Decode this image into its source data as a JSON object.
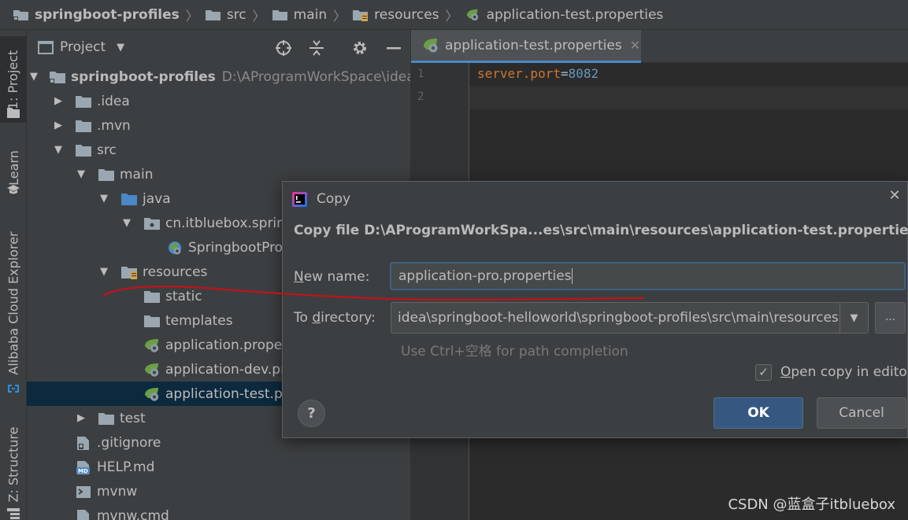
{
  "breadcrumb": [
    {
      "label": "springboot-profiles",
      "icon": "module-folder-icon"
    },
    {
      "label": "src",
      "icon": "folder-icon"
    },
    {
      "label": "main",
      "icon": "folder-icon"
    },
    {
      "label": "resources",
      "icon": "resources-folder-icon"
    },
    {
      "label": "application-test.properties",
      "icon": "spring-properties-icon"
    }
  ],
  "toolstrip": {
    "project": "1: Project",
    "learn": "Learn",
    "alibaba": "Alibaba Cloud Explorer",
    "structure": "Z: Structure"
  },
  "project_panel": {
    "title": "Project",
    "root_name": "springboot-profiles",
    "root_path": "D:\\AProgramWorkSpace\\idea\\s",
    "items": [
      {
        "label": ".idea",
        "level": 1,
        "icon": "folder-icon",
        "arrow": "collapsed"
      },
      {
        "label": ".mvn",
        "level": 1,
        "icon": "folder-icon",
        "arrow": "collapsed"
      },
      {
        "label": "src",
        "level": 1,
        "icon": "folder-icon",
        "arrow": "expanded"
      },
      {
        "label": "main",
        "level": 2,
        "icon": "folder-icon",
        "arrow": "expanded"
      },
      {
        "label": "java",
        "level": 3,
        "icon": "source-folder-icon",
        "arrow": "expanded"
      },
      {
        "label": "cn.itbluebox.sprin",
        "level": 4,
        "icon": "package-icon",
        "arrow": "expanded"
      },
      {
        "label": "SpringbootPro",
        "level": 5,
        "icon": "spring-class-icon",
        "arrow": "none"
      },
      {
        "label": "resources",
        "level": 3,
        "icon": "resources-folder-icon",
        "arrow": "expanded"
      },
      {
        "label": "static",
        "level": 4,
        "icon": "folder-icon",
        "arrow": "none"
      },
      {
        "label": "templates",
        "level": 4,
        "icon": "folder-icon",
        "arrow": "none"
      },
      {
        "label": "application.proper",
        "level": 4,
        "icon": "spring-properties-icon",
        "arrow": "none"
      },
      {
        "label": "application-dev.pr",
        "level": 4,
        "icon": "spring-properties-icon",
        "arrow": "none"
      },
      {
        "label": "application-test.pr",
        "level": 4,
        "icon": "spring-properties-icon",
        "arrow": "none",
        "selected": true
      },
      {
        "label": "test",
        "level": 2,
        "icon": "folder-icon",
        "arrow": "collapsed"
      },
      {
        "label": ".gitignore",
        "level": 1,
        "icon": "gitignore-file-icon",
        "arrow": "none"
      },
      {
        "label": "HELP.md",
        "level": 1,
        "icon": "markdown-file-icon",
        "arrow": "none"
      },
      {
        "label": "mvnw",
        "level": 1,
        "icon": "shell-script-icon",
        "arrow": "none"
      },
      {
        "label": "mvnw.cmd",
        "level": 1,
        "icon": "text-file-icon",
        "arrow": "none"
      }
    ]
  },
  "editor": {
    "tab_label": "application-test.properties",
    "line_numbers": [
      "1",
      "2"
    ],
    "code_key": "server.port",
    "code_eq": "=",
    "code_value": "8082"
  },
  "dialog": {
    "title": "Copy",
    "heading": "Copy file D:\\AProgramWorkSpa...es\\src\\main\\resources\\application-test.properties",
    "new_name_label_mnemonic": "N",
    "new_name_label_rest": "ew name:",
    "new_name_value": "application-pro.properties",
    "to_dir_label_pre": "To ",
    "to_dir_label_mnemonic": "d",
    "to_dir_label_rest": "irectory:",
    "directory_value": "idea\\springboot-helloworld\\springboot-profiles\\src\\main\\resources",
    "browse_label": "...",
    "hint": "Use Ctrl+空格 for path completion",
    "open_copy_mnemonic": "O",
    "open_copy_rest": "pen copy in editor",
    "open_copy_checked": true,
    "help_label": "?",
    "ok_label": "OK",
    "cancel_label": "Cancel"
  },
  "watermark": "CSDN @蓝盒子itbluebox",
  "colors": {
    "accent_selection": "#0d293e",
    "ok_button": "#365880",
    "annotation_line": "#c0121a",
    "spring_green": "#6a9f47"
  }
}
